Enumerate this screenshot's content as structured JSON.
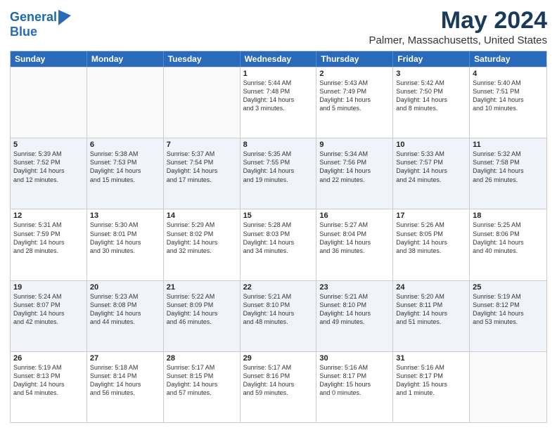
{
  "header": {
    "logo_line1": "General",
    "logo_line2": "Blue",
    "title": "May 2024",
    "subtitle": "Palmer, Massachusetts, United States"
  },
  "weekdays": [
    "Sunday",
    "Monday",
    "Tuesday",
    "Wednesday",
    "Thursday",
    "Friday",
    "Saturday"
  ],
  "rows": [
    [
      {
        "day": "",
        "info": ""
      },
      {
        "day": "",
        "info": ""
      },
      {
        "day": "",
        "info": ""
      },
      {
        "day": "1",
        "info": "Sunrise: 5:44 AM\nSunset: 7:48 PM\nDaylight: 14 hours\nand 3 minutes."
      },
      {
        "day": "2",
        "info": "Sunrise: 5:43 AM\nSunset: 7:49 PM\nDaylight: 14 hours\nand 5 minutes."
      },
      {
        "day": "3",
        "info": "Sunrise: 5:42 AM\nSunset: 7:50 PM\nDaylight: 14 hours\nand 8 minutes."
      },
      {
        "day": "4",
        "info": "Sunrise: 5:40 AM\nSunset: 7:51 PM\nDaylight: 14 hours\nand 10 minutes."
      }
    ],
    [
      {
        "day": "5",
        "info": "Sunrise: 5:39 AM\nSunset: 7:52 PM\nDaylight: 14 hours\nand 12 minutes."
      },
      {
        "day": "6",
        "info": "Sunrise: 5:38 AM\nSunset: 7:53 PM\nDaylight: 14 hours\nand 15 minutes."
      },
      {
        "day": "7",
        "info": "Sunrise: 5:37 AM\nSunset: 7:54 PM\nDaylight: 14 hours\nand 17 minutes."
      },
      {
        "day": "8",
        "info": "Sunrise: 5:35 AM\nSunset: 7:55 PM\nDaylight: 14 hours\nand 19 minutes."
      },
      {
        "day": "9",
        "info": "Sunrise: 5:34 AM\nSunset: 7:56 PM\nDaylight: 14 hours\nand 22 minutes."
      },
      {
        "day": "10",
        "info": "Sunrise: 5:33 AM\nSunset: 7:57 PM\nDaylight: 14 hours\nand 24 minutes."
      },
      {
        "day": "11",
        "info": "Sunrise: 5:32 AM\nSunset: 7:58 PM\nDaylight: 14 hours\nand 26 minutes."
      }
    ],
    [
      {
        "day": "12",
        "info": "Sunrise: 5:31 AM\nSunset: 7:59 PM\nDaylight: 14 hours\nand 28 minutes."
      },
      {
        "day": "13",
        "info": "Sunrise: 5:30 AM\nSunset: 8:01 PM\nDaylight: 14 hours\nand 30 minutes."
      },
      {
        "day": "14",
        "info": "Sunrise: 5:29 AM\nSunset: 8:02 PM\nDaylight: 14 hours\nand 32 minutes."
      },
      {
        "day": "15",
        "info": "Sunrise: 5:28 AM\nSunset: 8:03 PM\nDaylight: 14 hours\nand 34 minutes."
      },
      {
        "day": "16",
        "info": "Sunrise: 5:27 AM\nSunset: 8:04 PM\nDaylight: 14 hours\nand 36 minutes."
      },
      {
        "day": "17",
        "info": "Sunrise: 5:26 AM\nSunset: 8:05 PM\nDaylight: 14 hours\nand 38 minutes."
      },
      {
        "day": "18",
        "info": "Sunrise: 5:25 AM\nSunset: 8:06 PM\nDaylight: 14 hours\nand 40 minutes."
      }
    ],
    [
      {
        "day": "19",
        "info": "Sunrise: 5:24 AM\nSunset: 8:07 PM\nDaylight: 14 hours\nand 42 minutes."
      },
      {
        "day": "20",
        "info": "Sunrise: 5:23 AM\nSunset: 8:08 PM\nDaylight: 14 hours\nand 44 minutes."
      },
      {
        "day": "21",
        "info": "Sunrise: 5:22 AM\nSunset: 8:09 PM\nDaylight: 14 hours\nand 46 minutes."
      },
      {
        "day": "22",
        "info": "Sunrise: 5:21 AM\nSunset: 8:10 PM\nDaylight: 14 hours\nand 48 minutes."
      },
      {
        "day": "23",
        "info": "Sunrise: 5:21 AM\nSunset: 8:10 PM\nDaylight: 14 hours\nand 49 minutes."
      },
      {
        "day": "24",
        "info": "Sunrise: 5:20 AM\nSunset: 8:11 PM\nDaylight: 14 hours\nand 51 minutes."
      },
      {
        "day": "25",
        "info": "Sunrise: 5:19 AM\nSunset: 8:12 PM\nDaylight: 14 hours\nand 53 minutes."
      }
    ],
    [
      {
        "day": "26",
        "info": "Sunrise: 5:19 AM\nSunset: 8:13 PM\nDaylight: 14 hours\nand 54 minutes."
      },
      {
        "day": "27",
        "info": "Sunrise: 5:18 AM\nSunset: 8:14 PM\nDaylight: 14 hours\nand 56 minutes."
      },
      {
        "day": "28",
        "info": "Sunrise: 5:17 AM\nSunset: 8:15 PM\nDaylight: 14 hours\nand 57 minutes."
      },
      {
        "day": "29",
        "info": "Sunrise: 5:17 AM\nSunset: 8:16 PM\nDaylight: 14 hours\nand 59 minutes."
      },
      {
        "day": "30",
        "info": "Sunrise: 5:16 AM\nSunset: 8:17 PM\nDaylight: 15 hours\nand 0 minutes."
      },
      {
        "day": "31",
        "info": "Sunrise: 5:16 AM\nSunset: 8:17 PM\nDaylight: 15 hours\nand 1 minute."
      },
      {
        "day": "",
        "info": ""
      }
    ]
  ]
}
